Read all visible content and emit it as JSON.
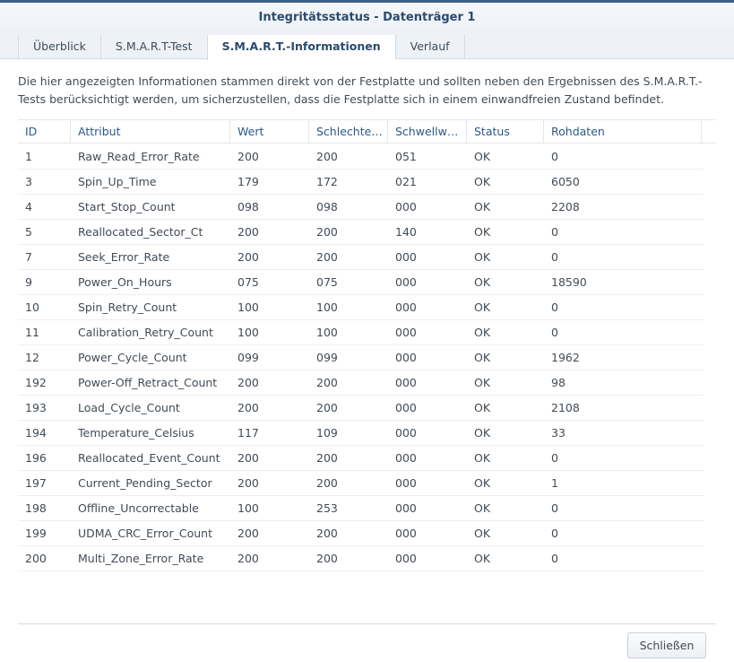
{
  "window": {
    "title": "Integritätsstatus - Datenträger 1"
  },
  "tabs": [
    {
      "label": "Überblick",
      "active": false
    },
    {
      "label": "S.M.A.R.T-Test",
      "active": false
    },
    {
      "label": "S.M.A.R.T.-Informationen",
      "active": true
    },
    {
      "label": "Verlauf",
      "active": false
    }
  ],
  "description": "Die hier angezeigten Informationen stammen direkt von der Festplatte und sollten neben den Ergebnissen des S.M.A.R.T.-Tests berücksichtigt werden, um sicherzustellen, dass die Festplatte sich in einem einwandfreien Zustand befindet.",
  "table": {
    "columns": [
      "ID",
      "Attribut",
      "Wert",
      "Schlechte…",
      "Schwellw…",
      "Status",
      "Rohdaten"
    ],
    "rows": [
      [
        "1",
        "Raw_Read_Error_Rate",
        "200",
        "200",
        "051",
        "OK",
        "0"
      ],
      [
        "3",
        "Spin_Up_Time",
        "179",
        "172",
        "021",
        "OK",
        "6050"
      ],
      [
        "4",
        "Start_Stop_Count",
        "098",
        "098",
        "000",
        "OK",
        "2208"
      ],
      [
        "5",
        "Reallocated_Sector_Ct",
        "200",
        "200",
        "140",
        "OK",
        "0"
      ],
      [
        "7",
        "Seek_Error_Rate",
        "200",
        "200",
        "000",
        "OK",
        "0"
      ],
      [
        "9",
        "Power_On_Hours",
        "075",
        "075",
        "000",
        "OK",
        "18590"
      ],
      [
        "10",
        "Spin_Retry_Count",
        "100",
        "100",
        "000",
        "OK",
        "0"
      ],
      [
        "11",
        "Calibration_Retry_Count",
        "100",
        "100",
        "000",
        "OK",
        "0"
      ],
      [
        "12",
        "Power_Cycle_Count",
        "099",
        "099",
        "000",
        "OK",
        "1962"
      ],
      [
        "192",
        "Power-Off_Retract_Count",
        "200",
        "200",
        "000",
        "OK",
        "98"
      ],
      [
        "193",
        "Load_Cycle_Count",
        "200",
        "200",
        "000",
        "OK",
        "2108"
      ],
      [
        "194",
        "Temperature_Celsius",
        "117",
        "109",
        "000",
        "OK",
        "33"
      ],
      [
        "196",
        "Reallocated_Event_Count",
        "200",
        "200",
        "000",
        "OK",
        "0"
      ],
      [
        "197",
        "Current_Pending_Sector",
        "200",
        "200",
        "000",
        "OK",
        "1"
      ],
      [
        "198",
        "Offline_Uncorrectable",
        "100",
        "253",
        "000",
        "OK",
        "0"
      ],
      [
        "199",
        "UDMA_CRC_Error_Count",
        "200",
        "200",
        "000",
        "OK",
        "0"
      ],
      [
        "200",
        "Multi_Zone_Error_Rate",
        "200",
        "200",
        "000",
        "OK",
        "0"
      ]
    ]
  },
  "footer": {
    "close_label": "Schließen"
  },
  "colors": {
    "title": "#2b4a6e",
    "header_text": "#2b5a8a",
    "accent_bar": "#3d5f86"
  }
}
